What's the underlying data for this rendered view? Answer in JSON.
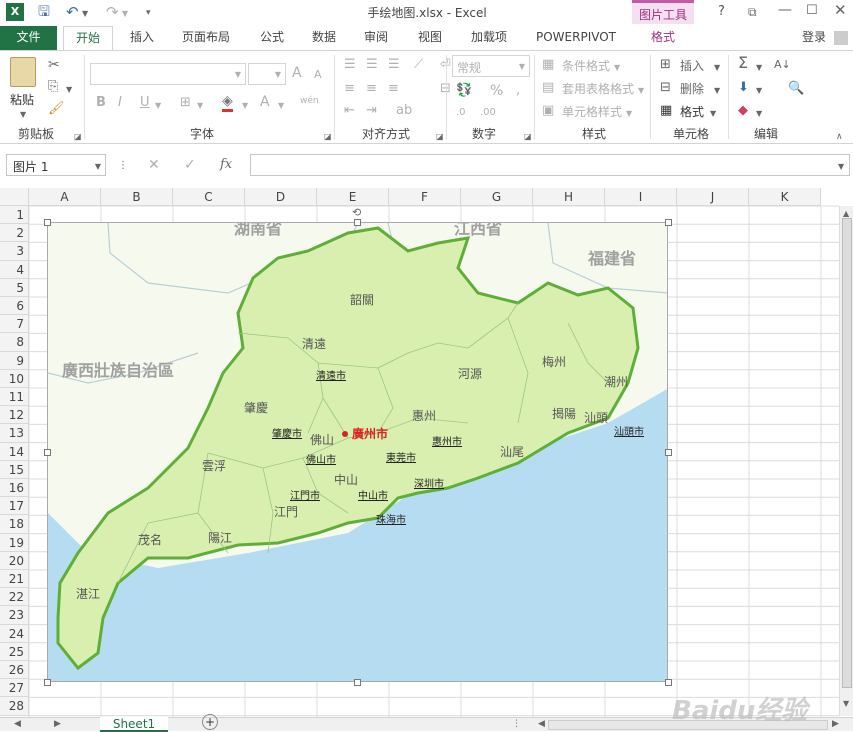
{
  "window": {
    "title": "手绘地图.xlsx - Excel",
    "context_tab": "图片工具",
    "help": "?"
  },
  "tabs": [
    {
      "label": "文件"
    },
    {
      "label": "开始"
    },
    {
      "label": "插入"
    },
    {
      "label": "页面布局"
    },
    {
      "label": "公式"
    },
    {
      "label": "数据"
    },
    {
      "label": "审阅"
    },
    {
      "label": "视图"
    },
    {
      "label": "加载项"
    },
    {
      "label": "POWERPIVOT"
    },
    {
      "label": "格式"
    }
  ],
  "login": "登录",
  "ribbon": {
    "clipboard": {
      "paste": "粘贴",
      "group": "剪贴板"
    },
    "font": {
      "group": "字体",
      "bold": "B",
      "italic": "I",
      "underline": "U",
      "grow": "A",
      "shrink": "A",
      "font_color": "A",
      "wen": "wén"
    },
    "align": {
      "group": "对齐方式"
    },
    "number": {
      "group": "数字",
      "format": "常规",
      "percent": "%"
    },
    "styles": {
      "group": "样式",
      "cond": "条件格式",
      "table": "套用表格格式",
      "cell": "单元格样式"
    },
    "cells": {
      "group": "单元格",
      "insert": "插入",
      "delete": "删除",
      "format": "格式"
    },
    "editing": {
      "group": "编辑"
    }
  },
  "formula_bar": {
    "name_box": "图片 1",
    "fx": "fx",
    "value": ""
  },
  "columns": [
    "A",
    "B",
    "C",
    "D",
    "E",
    "F",
    "G",
    "H",
    "I",
    "J",
    "K"
  ],
  "rows": [
    "1",
    "2",
    "3",
    "4",
    "5",
    "6",
    "7",
    "8",
    "9",
    "10",
    "11",
    "12",
    "13",
    "14",
    "15",
    "16",
    "17",
    "18",
    "19",
    "20",
    "21",
    "22",
    "23",
    "24",
    "25",
    "26",
    "27",
    "28"
  ],
  "map": {
    "provinces": [
      "湖南省",
      "江西省",
      "福建省",
      "廣西壯族自治區"
    ],
    "regions": [
      "韶關",
      "清遠",
      "河源",
      "梅州",
      "潮州",
      "肇慶",
      "揭陽",
      "汕頭",
      "佛山",
      "惠州",
      "汕尾",
      "雲浮",
      "中山",
      "江門",
      "茂名",
      "陽江",
      "湛江"
    ],
    "cities": [
      "清遠市",
      "肇慶市",
      "廣州市",
      "惠州市",
      "佛山市",
      "東莞市",
      "深圳市",
      "江門市",
      "中山市",
      "珠海市",
      "汕頭市"
    ],
    "colors": {
      "land": "#d9efb0",
      "border": "#5fae37",
      "sea": "#b5dcf0",
      "bg": "#f6faee",
      "capital": "#e02020"
    }
  },
  "sheet": {
    "tab": "Sheet1",
    "add": "+"
  },
  "watermark": "Baidu经验"
}
